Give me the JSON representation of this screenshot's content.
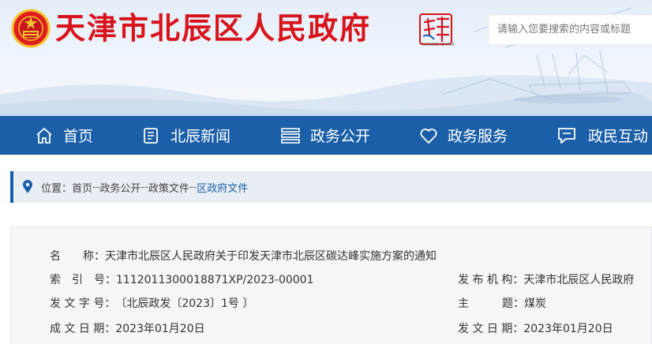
{
  "site": {
    "title": "天津市北辰区人民政府",
    "seal_text": "天津",
    "seal_caption": "TIANJIN CHINA"
  },
  "search": {
    "placeholder": "请输入您要搜索的内容或标题"
  },
  "nav": {
    "items": [
      {
        "label": "首页",
        "icon": "home-icon"
      },
      {
        "label": "北辰新闻",
        "icon": "news-icon"
      },
      {
        "label": "政务公开",
        "icon": "list-icon"
      },
      {
        "label": "政务服务",
        "icon": "heart-icon"
      },
      {
        "label": "政民互动",
        "icon": "chat-icon"
      }
    ]
  },
  "breadcrumb": {
    "prefix": "位置：",
    "items": [
      "首页",
      "政务公开",
      "政策文件",
      "区政府文件"
    ],
    "separator": "--"
  },
  "document_info": {
    "name_label": "名　　称：",
    "name_value": "天津市北辰区人民政府关于印发天津市北辰区碳达峰实施方案的通知",
    "index_label": "索　引　号：",
    "index_value": "1112011300018871XP/2023-00001",
    "issuer_label": "发 布 机 构：",
    "issuer_value": "天津市北辰区人民政府",
    "doc_no_label": "发 文 字 号：",
    "doc_no_value": "〔北辰政发〔2023〕1号 〕",
    "subject_label": "主　　　题：",
    "subject_value": "煤炭",
    "written_date_label": "成 文 日 期：",
    "written_date_value": "2023年01月20日",
    "publish_date_label": "发 文 日 期：",
    "publish_date_value": "2023年01月20日"
  },
  "colors": {
    "brand_red": "#d8131b",
    "nav_blue": "#1a5fa8",
    "breadcrumb_bg": "#e9eef4",
    "panel_bg": "#f4f6f9"
  }
}
